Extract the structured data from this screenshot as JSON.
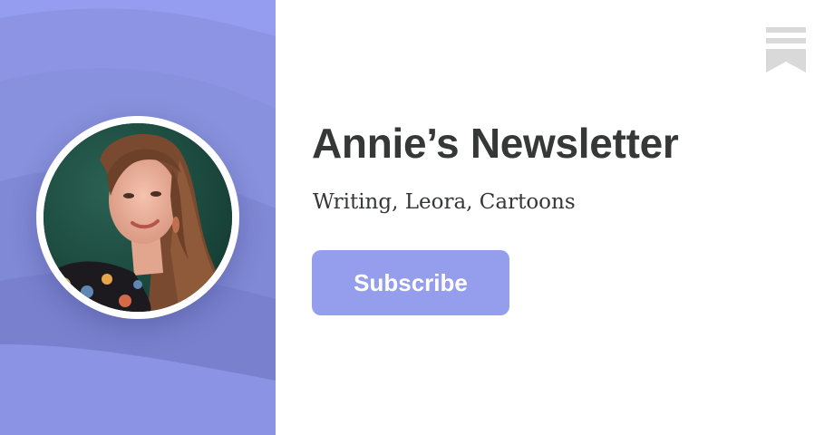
{
  "newsletter": {
    "title": "Annie’s Newsletter",
    "tagline": "Writing, Leora, Cartoons"
  },
  "actions": {
    "subscribe_label": "Subscribe"
  },
  "icons": {
    "brand": "substack-logo-icon",
    "avatar": "author-portrait-photo"
  },
  "colors": {
    "panel": "#8b93e0",
    "accent": "#959ded",
    "title_text": "#363737",
    "brand_logo": "#d9d9d9"
  }
}
